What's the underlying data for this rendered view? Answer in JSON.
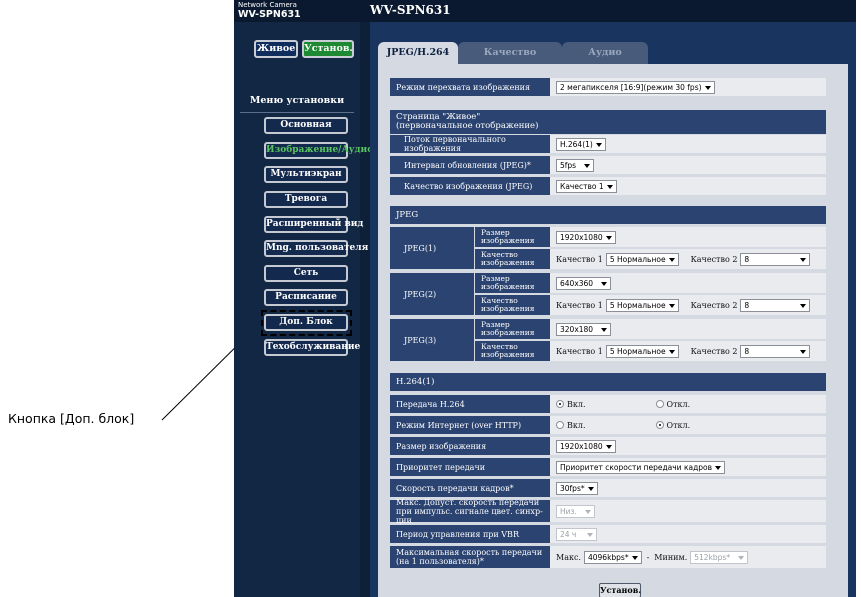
{
  "callout": {
    "label": "Кнопка [Доп. блок]"
  },
  "header": {
    "brand_line1": "Network Camera",
    "brand_line2": "WV-SPN631",
    "title": "WV-SPN631"
  },
  "sidebar": {
    "live_label": "Живое",
    "setup_label": "Установ.",
    "menu_title": "Меню установки",
    "items": [
      {
        "label": "Основная",
        "active": false
      },
      {
        "label": "Изображение/Аудио",
        "active": true
      },
      {
        "label": "Мультиэкран",
        "active": false
      },
      {
        "label": "Тревога",
        "active": false
      },
      {
        "label": "Расширенный вид",
        "active": false
      },
      {
        "label": "Mng. пользователя",
        "active": false
      },
      {
        "label": "Сеть",
        "active": false
      },
      {
        "label": "Расписание",
        "active": false
      },
      {
        "label": "Доп. Блок",
        "active": false
      },
      {
        "label": "Техобслуживание",
        "active": false
      }
    ]
  },
  "tabs": [
    {
      "label": "JPEG/H.264",
      "selected": true
    },
    {
      "label": "Качество изображения",
      "selected": false
    },
    {
      "label": "Аудио",
      "selected": false
    }
  ],
  "form": {
    "capture_mode": {
      "label": "Режим перехвата изображения",
      "value": "2 мегапикселя [16:9](режим 30 fps)"
    },
    "live_page": {
      "header": "Страница \"Живое\" (первоначальное отображение)",
      "initial_stream": {
        "label": "Поток первоначального изображения",
        "value": "H.264(1)"
      },
      "refresh_interval": {
        "label": "Интервал обновления (JPEG)*",
        "value": "5fps"
      },
      "jpeg_quality": {
        "label": "Качество изображения (JPEG)",
        "value": "Качество 1"
      }
    },
    "jpeg": {
      "header": "JPEG",
      "size_label": "Размер изображения",
      "quality_label": "Качество изображения",
      "q1_label": "Качество 1",
      "q2_label": "Качество 2",
      "rows": [
        {
          "name": "JPEG(1)",
          "size": "1920x1080",
          "q1": "5 Нормальное",
          "q2": "8"
        },
        {
          "name": "JPEG(2)",
          "size": "640x360",
          "q1": "5 Нормальное",
          "q2": "8"
        },
        {
          "name": "JPEG(3)",
          "size": "320x180",
          "q1": "5 Нормальное",
          "q2": "8"
        }
      ]
    },
    "h264": {
      "header": "H.264(1)",
      "on_label": "Вкл.",
      "off_label": "Откл.",
      "transmission": {
        "label": "Передача H.264",
        "value": "on"
      },
      "internet_mode": {
        "label": "Режим Интернет (over HTTP)",
        "value": "off"
      },
      "image_size": {
        "label": "Размер изображения",
        "value": "1920x1080"
      },
      "priority": {
        "label": "Приоритет передачи",
        "value": "Приоритет скорости передачи кадров"
      },
      "frame_rate": {
        "label": "Скорость передачи кадров*",
        "value": "30fps*"
      },
      "max_bitrate_burst": {
        "label": "Макс. Допуст. скорость передачи при импульс. сигнале цвет. синхр-ции",
        "value": "Низ."
      },
      "vbr_period": {
        "label": "Период управления при VBR",
        "value": "24 ч"
      },
      "max_bitrate": {
        "label": "Максимальная скорость передачи (на 1 пользователя)*",
        "max_label": "Макс.",
        "max_value": "4096kbps*",
        "dash": "-",
        "min_label": "Миним.",
        "min_value": "512kbps*"
      }
    },
    "submit_label": "Установ."
  }
}
